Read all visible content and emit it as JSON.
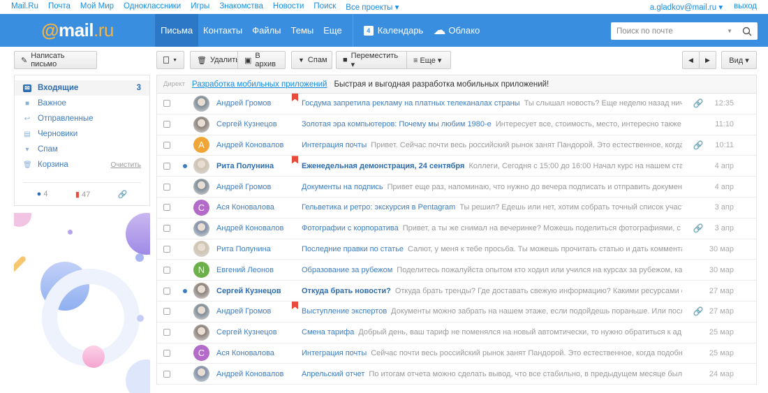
{
  "topbar": {
    "links": [
      "Mail.Ru",
      "Почта",
      "Мой Мир",
      "Одноклассники",
      "Игры",
      "Знакомства",
      "Новости",
      "Поиск",
      "Все проекты ▾"
    ],
    "user": "a.gladkov@mail.ru ▾",
    "logout": "выход"
  },
  "header": {
    "logo_at": "@",
    "logo_mail": "mail",
    "logo_ru": ".ru",
    "nav": [
      "Письма",
      "Контакты",
      "Файлы",
      "Темы",
      "Еще"
    ],
    "calendar": "Календарь",
    "calendar_day": "4",
    "cloud": "Облако",
    "search_placeholder": "Поиск по почте"
  },
  "toolbar": {
    "compose": "Написать письмо",
    "delete": "Удалить",
    "archive": "В архив",
    "spam": "Спам",
    "move": "Переместить ▾",
    "more": "≡ Еще ▾",
    "view": "Вид ▾"
  },
  "folders": [
    {
      "label": "Входящие",
      "count": "3",
      "icon": "envelope-icon",
      "glyph": "✉"
    },
    {
      "label": "Важное",
      "icon": "folder-icon",
      "glyph": "■"
    },
    {
      "label": "Отправленные",
      "icon": "reply-icon",
      "glyph": "↩"
    },
    {
      "label": "Черновики",
      "icon": "draft-icon",
      "glyph": "▤"
    },
    {
      "label": "Спам",
      "icon": "thumbs-down-icon",
      "glyph": "▾"
    },
    {
      "label": "Корзина",
      "icon": "trash-icon",
      "glyph": "🗑",
      "action": "Очистить"
    }
  ],
  "filters": {
    "unread": "4",
    "flagged": "47"
  },
  "ad": {
    "label": "Директ",
    "link": "Разработка мобильных приложений",
    "text": "Быстрая и выгодная разработка мобильных приложений!"
  },
  "colors": {
    "accent": "#3a8ee0",
    "link": "#3d7cc0",
    "flag": "#e84a3b"
  },
  "messages": [
    {
      "from": "Андрей Громов",
      "subject": "Госдума запретила рекламу на платных телеканалах страны",
      "preview": "Ты слышал новость? Еще неделю назад ничего не",
      "date": "12:35",
      "attach": true,
      "flag": true,
      "avatar": "photo",
      "color": "#7d8a94"
    },
    {
      "from": "Сергей Кузнецов",
      "subject": "Золотая эра компьютеров: Почему мы любим 1980-е",
      "preview": "Интересует все, стоимость, место, интересно также посмо",
      "date": "11:10",
      "avatar": "photo",
      "color": "#8a7f78"
    },
    {
      "from": "Андрей Коновалов",
      "subject": "Интеграция почты",
      "preview": "Привет. Сейчас почти весь российский рынок занят Пандорой. Это естественное, когда у вас",
      "date": "10:11",
      "attach": true,
      "avatar": "A",
      "color": "#f0a537"
    },
    {
      "from": "Рита Полунина",
      "subject": "Еженедельная демонстрация, 24 сентября",
      "preview": "Коллеги, Сегодня с 15:00 до 16:00  Начал курс на нашем стандарт",
      "date": "4 апр",
      "unread": true,
      "flag": true,
      "avatar": "photo",
      "color": "#cfc2b0"
    },
    {
      "from": "Андрей Громов",
      "subject": "Документы на подпись",
      "preview": "Привет еще раз, напоминаю, что нужно до вечера подписать и отправить документы пост",
      "date": "4 апр",
      "avatar": "photo",
      "color": "#7d8a94"
    },
    {
      "from": "Ася Коновалова",
      "subject": "Гельветика и ретро: экскурсия в Pentagram",
      "preview": "Ты решил? Едешь или нет, хотим собрать точный список участников",
      "date": "3 апр",
      "avatar": "C",
      "color": "#b46ac8"
    },
    {
      "from": "Андрей Коновалов",
      "subject": "Фотографии с корпоратива",
      "preview": "Привет, а ты же снимал на вечеринке? Можешь поделиться фотографиями, с мен",
      "date": "3 апр",
      "attach": true,
      "avatar": "photo",
      "color": "#7e8ea6"
    },
    {
      "from": "Рита Полунина",
      "subject": "Последние правки по статье",
      "preview": "Салют, у меня к тебе просьба. Ты можешь прочитать статью и дать комментарии, е",
      "date": "30 мар",
      "avatar": "photo",
      "color": "#cfc2b0"
    },
    {
      "from": "Евгений Леонов",
      "subject": "Образование за рубежом",
      "preview": "Поделитесь пожалуйста опытом кто ходил или учился на курсах за рубежом, какеи под",
      "date": "30 мар",
      "avatar": "N",
      "color": "#6cb04a"
    },
    {
      "from": "Сергей Кузнецов",
      "subject": "Откуда брать новости?",
      "preview": "Откуда брать тренды? Где доставать свежую информацию? Какими ресурсами сейчас",
      "date": "27 мар",
      "unread": true,
      "avatar": "photo",
      "color": "#8a7f78"
    },
    {
      "from": "Андрей Громов",
      "subject": "Выступление экспертов",
      "preview": "Документы можно забрать на нашем этаже, если подойдешь пораньше. Или после выс",
      "date": "27 мар",
      "attach": true,
      "flag": true,
      "avatar": "photo",
      "color": "#7d8a94"
    },
    {
      "from": "Сергей Кузнецов",
      "subject": "Смена тарифа",
      "preview": "Добрый день, ваш тариф не поменялся на новый автомтически, то нужно обратиться к админис",
      "date": "25 мар",
      "avatar": "photo",
      "color": "#8a7f78"
    },
    {
      "from": "Ася Коновалова",
      "subject": "Интеграция почты",
      "preview": "Сейчас почти весь российский рынок занят Пандорой. Это естественное, когда подобные се",
      "date": "25 мар",
      "avatar": "C",
      "color": "#b46ac8"
    },
    {
      "from": "Андрей Коновалов",
      "subject": "Апрельский отчет",
      "preview": "По итогам отчета можно сделать вывод, что все стабильно, в предыдущем месяце были такие",
      "date": "24 мар",
      "avatar": "photo",
      "color": "#7e8ea6"
    }
  ]
}
